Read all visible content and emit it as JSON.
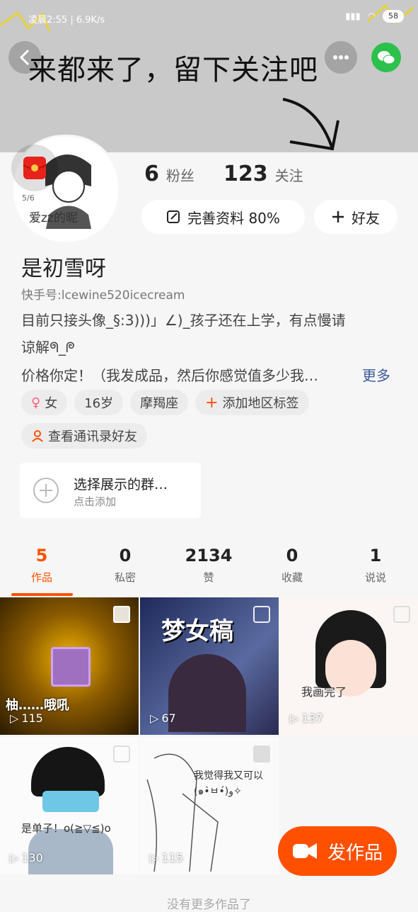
{
  "status_bar": {
    "time": "凌晨2:55 | 6.9K/s",
    "battery": "58"
  },
  "banner": {
    "text": "来都来了，留下关注吧"
  },
  "profile": {
    "fans_count": "6",
    "fans_label": "粉丝",
    "following_count": "123",
    "following_label": "关注",
    "edit_profile_label": "完善资料 80%",
    "add_friend_label": "好友",
    "avatar_caption": "爱zz的昵",
    "avatar_counter": "5/6",
    "name": "是初雪呀",
    "kuaishou_id": "快手号:lcewine520icecream",
    "bio_line1": "目前只接头像_§:3)))」∠)_孩子还在上学，有点慢请",
    "bio_line2": "谅解ᖗ_ᖘ",
    "bio_line3": "价格你定！（我发成品，然后你感觉值多少我…",
    "more_label": "更多",
    "tags": [
      "女",
      "16岁",
      "摩羯座",
      "添加地区标签"
    ],
    "contacts_label": "查看通讯录好友"
  },
  "group_card": {
    "title": "选择展示的群…",
    "subtitle": "点击添加"
  },
  "tabs": [
    {
      "num": "5",
      "label": "作品"
    },
    {
      "num": "0",
      "label": "私密"
    },
    {
      "num": "2134",
      "label": "赞"
    },
    {
      "num": "0",
      "label": "收藏"
    },
    {
      "num": "1",
      "label": "说说"
    }
  ],
  "works": [
    {
      "plays": "115",
      "caption": "柚……哦吼"
    },
    {
      "plays": "67",
      "caption": "梦女稿"
    },
    {
      "plays": "137",
      "caption": "我画完了"
    },
    {
      "plays": "130",
      "caption": "是单子！o(≧▽≦)o"
    },
    {
      "plays": "115",
      "caption": "我觉得我又可以(๑•̀ㅂ•́)و✧"
    }
  ],
  "post_button": "发作品",
  "footer": "没有更多作品了",
  "colors": {
    "accent": "#ff5000",
    "wechat": "#2cc14c"
  }
}
